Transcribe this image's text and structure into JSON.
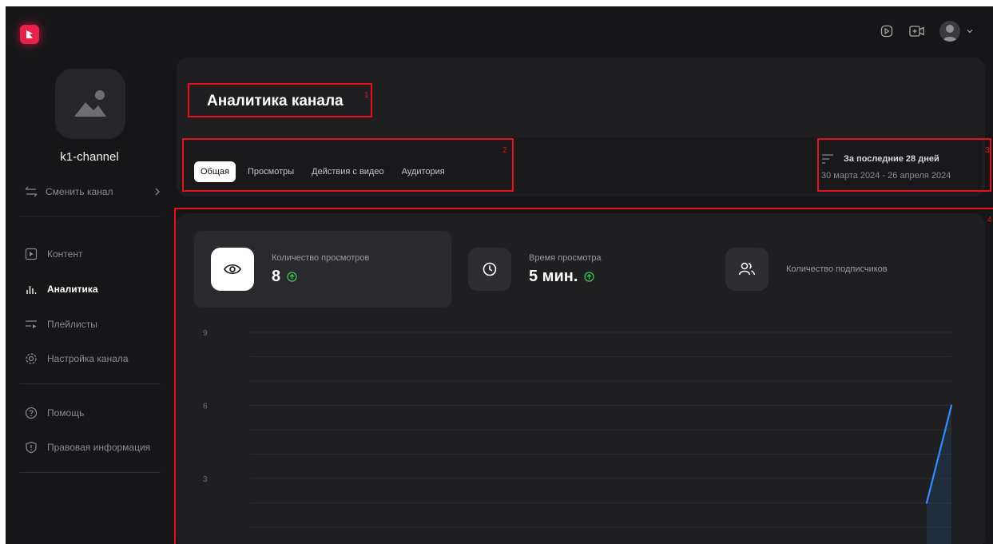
{
  "topbar": {
    "icons": [
      "logo-icon",
      "playlist-square-icon",
      "add-video-icon",
      "user-avatar-icon",
      "chevron-down-icon"
    ]
  },
  "sidebar": {
    "channel_name": "k1-channel",
    "switch_label": "Сменить канал",
    "items": [
      {
        "label": "Контент",
        "icon": "content-icon"
      },
      {
        "label": "Аналитика",
        "icon": "analytics-icon",
        "active": true
      },
      {
        "label": "Плейлисты",
        "icon": "playlist-icon"
      },
      {
        "label": "Настройка канала",
        "icon": "settings-icon"
      },
      {
        "label": "Помощь",
        "icon": "help-icon"
      },
      {
        "label": "Правовая информация",
        "icon": "legal-shield-icon"
      }
    ]
  },
  "header": {
    "title": "Аналитика канала",
    "tabs": [
      {
        "label": "Общая",
        "active": true
      },
      {
        "label": "Просмотры"
      },
      {
        "label": "Действия с видео"
      },
      {
        "label": "Аудитория"
      }
    ],
    "period_label": "За последние 28 дней",
    "period_range": "30 марта 2024 - 26 апреля 2024"
  },
  "markers": [
    "1",
    "2",
    "3",
    "4"
  ],
  "stats": [
    {
      "label": "Количество просмотров",
      "value": "8",
      "trend": "up",
      "icon": "eye-icon",
      "active": true
    },
    {
      "label": "Время просмотра",
      "value": "5 мин.",
      "trend": "up",
      "icon": "clock-icon"
    },
    {
      "label": "Количество подписчиков",
      "value": "",
      "icon": "users-icon"
    }
  ],
  "colors": {
    "accent": "#e8204a",
    "line": "#2f8fff",
    "trend_up": "#35c759",
    "marker": "#e8101a"
  },
  "chart_data": {
    "type": "line",
    "y_ticks": [
      "9",
      "6",
      "3"
    ],
    "ylim": [
      0,
      9
    ],
    "grid": true,
    "series": [
      {
        "values": [
          2,
          6
        ]
      }
    ]
  }
}
